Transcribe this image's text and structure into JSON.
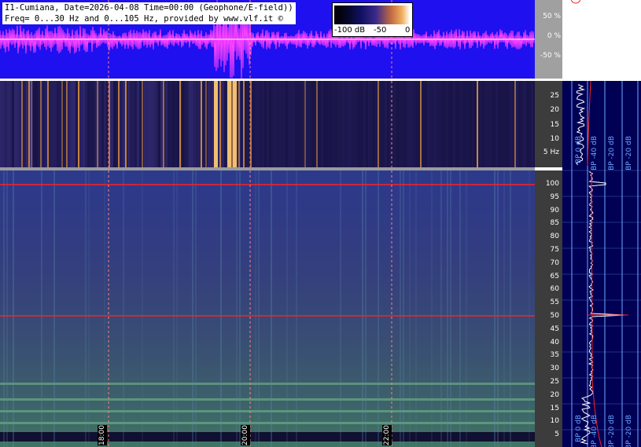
{
  "header": {
    "line1": "I1-Cumiana, Date=2026-04-08 Time=00:00 (Geophone/E-field))",
    "line2": "Freq= 0...30 Hz and 0...105 Hz, provided by www.vlf.it ©"
  },
  "colorbar": {
    "min_label": "-100 dB",
    "mid_label": "-50",
    "max_label": "0"
  },
  "wave_scale": {
    "labels": [
      "50 %",
      "0 %",
      "-50 %"
    ]
  },
  "top_axis": {
    "unit_label": "5 Hz",
    "ticks": [
      "25",
      "20",
      "15",
      "10"
    ]
  },
  "main_axis": {
    "ticks": [
      "100",
      "95",
      "90",
      "85",
      "80",
      "75",
      "70",
      "65",
      "60",
      "55",
      "50",
      "45",
      "40",
      "35",
      "30",
      "25",
      "20",
      "15",
      "10",
      "5"
    ]
  },
  "time_labels": [
    "18:00",
    "20:00",
    "22:00"
  ],
  "profile_top": {
    "bp_labels": [
      "BP 0 dB",
      "BP -40 dB",
      "BP -20 dB",
      "BP -20 dB"
    ]
  },
  "profile_main": {
    "bp_labels": [
      "BP 0 dB",
      "BP -40 dB",
      "BP -20 dB",
      "BP -20 dB"
    ]
  },
  "colors": {
    "wave_bg": "#1f10f0",
    "wave_trace": "#ff40ff",
    "marker_line": "#ff2020",
    "grid": "#6fa8ff"
  }
}
